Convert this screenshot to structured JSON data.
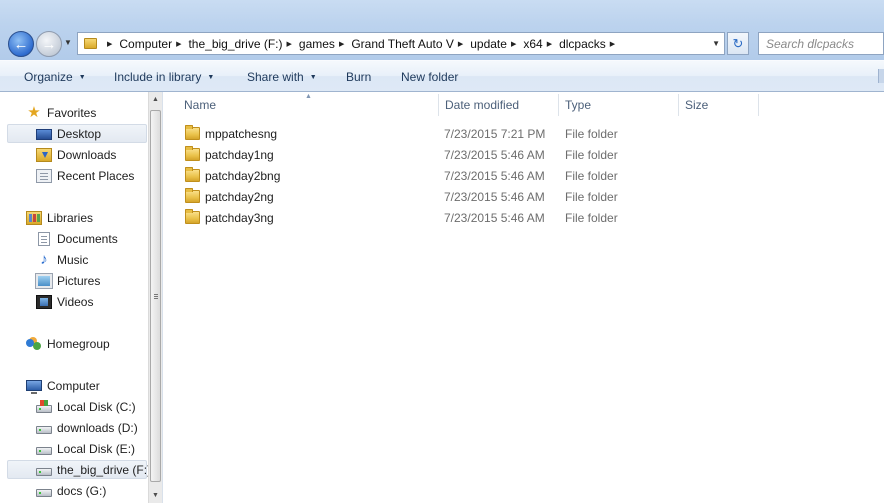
{
  "address_bar": {
    "breadcrumbs": [
      "Computer",
      "the_big_drive (F:)",
      "games",
      "Grand Theft Auto V",
      "update",
      "x64",
      "dlcpacks"
    ]
  },
  "search": {
    "placeholder": "Search dlcpacks"
  },
  "toolbar": {
    "organize": "Organize",
    "include_in_library": "Include in library",
    "share_with": "Share with",
    "burn": "Burn",
    "new_folder": "New folder"
  },
  "nav": {
    "favorites": {
      "label": "Favorites",
      "items": [
        "Desktop",
        "Downloads",
        "Recent Places"
      ]
    },
    "libraries": {
      "label": "Libraries",
      "items": [
        "Documents",
        "Music",
        "Pictures",
        "Videos"
      ]
    },
    "homegroup": {
      "label": "Homegroup"
    },
    "computer": {
      "label": "Computer",
      "items": [
        "Local Disk (C:)",
        "downloads (D:)",
        "Local Disk (E:)",
        "the_big_drive (F:)",
        "docs (G:)"
      ]
    }
  },
  "columns": {
    "name": "Name",
    "date_modified": "Date modified",
    "type": "Type",
    "size": "Size"
  },
  "files": [
    {
      "name": "mppatchesng",
      "date": "7/23/2015 7:21 PM",
      "type": "File folder"
    },
    {
      "name": "patchday1ng",
      "date": "7/23/2015 5:46 AM",
      "type": "File folder"
    },
    {
      "name": "patchday2bng",
      "date": "7/23/2015 5:46 AM",
      "type": "File folder"
    },
    {
      "name": "patchday2ng",
      "date": "7/23/2015 5:46 AM",
      "type": "File folder"
    },
    {
      "name": "patchday3ng",
      "date": "7/23/2015 5:46 AM",
      "type": "File folder"
    }
  ],
  "colors": {
    "accent": "#1e395b",
    "titlebar": "#bcd3ee",
    "selection": "#e3e9f1"
  }
}
